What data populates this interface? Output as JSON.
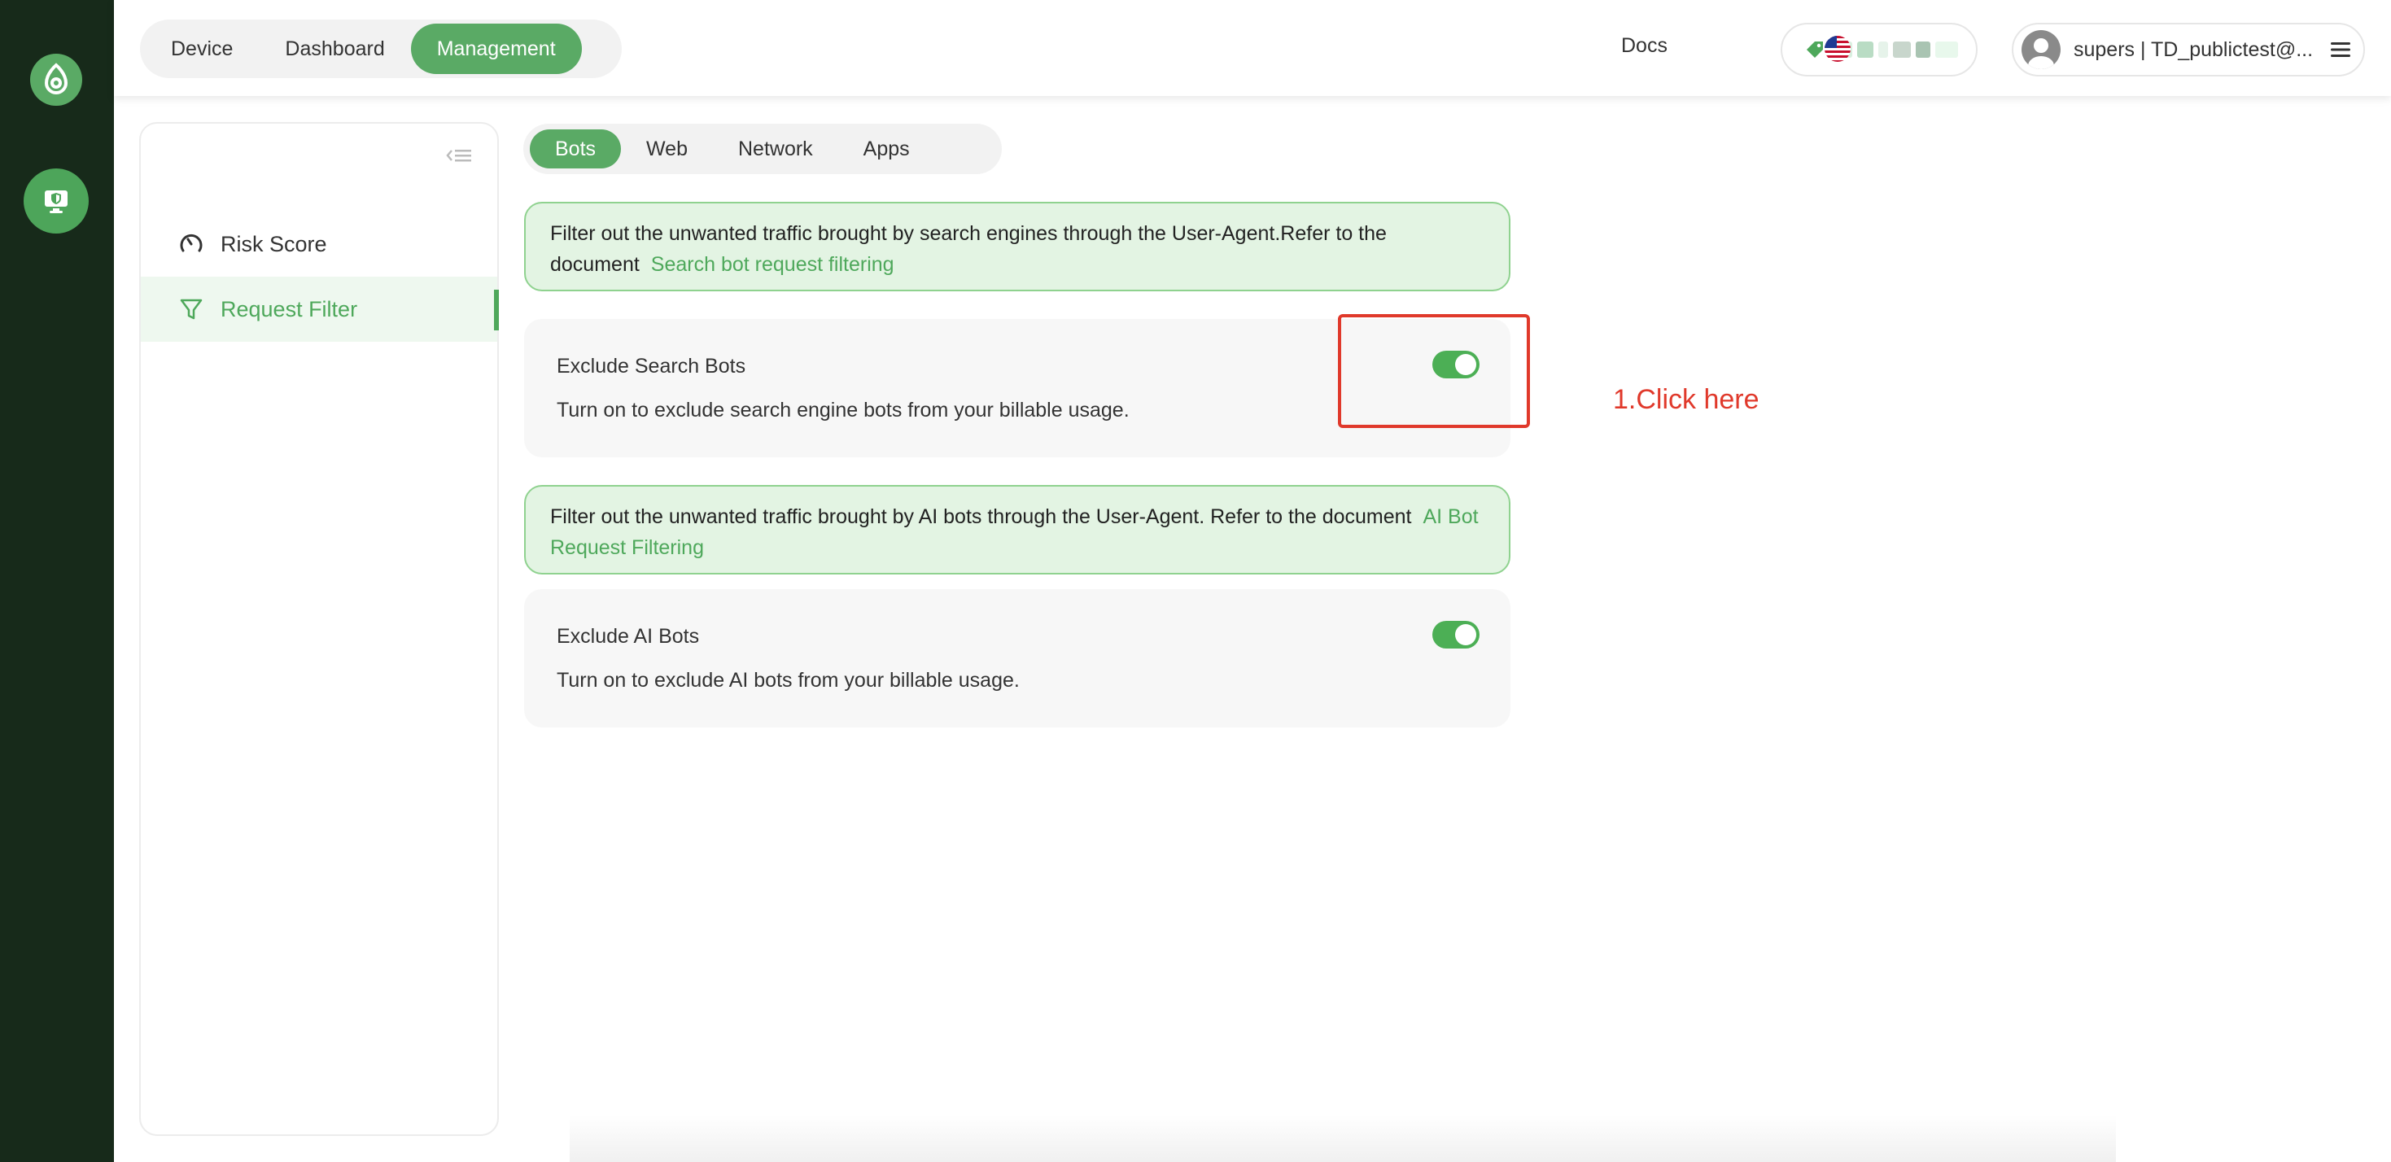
{
  "rail": {
    "logo_icon": "brand-logo-icon",
    "app_icon": "device-shield-icon"
  },
  "header": {
    "tabs": [
      {
        "label": "Device",
        "active": false
      },
      {
        "label": "Dashboard",
        "active": false
      },
      {
        "label": "Management",
        "active": true
      }
    ],
    "docs_label": "Docs",
    "language_icon": "us-flag-icon",
    "user_label": "supers | TD_publictest@...",
    "menu_icon": "hamburger-icon",
    "accent_color": "#5aaa65"
  },
  "sidebar": {
    "collapse_icon": "collapse-icon",
    "items": [
      {
        "label": "Risk Score",
        "icon": "gauge-icon",
        "active": false
      },
      {
        "label": "Request Filter",
        "icon": "filter-icon",
        "active": true
      }
    ]
  },
  "sub_tabs": [
    {
      "label": "Bots",
      "active": true
    },
    {
      "label": "Web",
      "active": false
    },
    {
      "label": "Network",
      "active": false
    },
    {
      "label": "Apps",
      "active": false
    }
  ],
  "search_bots": {
    "notice_text": "Filter out the unwanted traffic brought by search engines through the User-Agent.Refer to the document",
    "notice_link": "Search bot request filtering",
    "title": "Exclude Search Bots",
    "description": "Turn on to exclude search engine bots from your billable usage.",
    "enabled": true
  },
  "ai_bots": {
    "notice_text": "Filter out the unwanted traffic brought by AI bots through the User-Agent. Refer to the document",
    "notice_link": "AI Bot Request Filtering",
    "title": "Exclude AI Bots",
    "description": "Turn on to exclude AI bots from your billable usage.",
    "enabled": true
  },
  "annotation": {
    "text": "1.Click here",
    "color": "#e0392b"
  }
}
